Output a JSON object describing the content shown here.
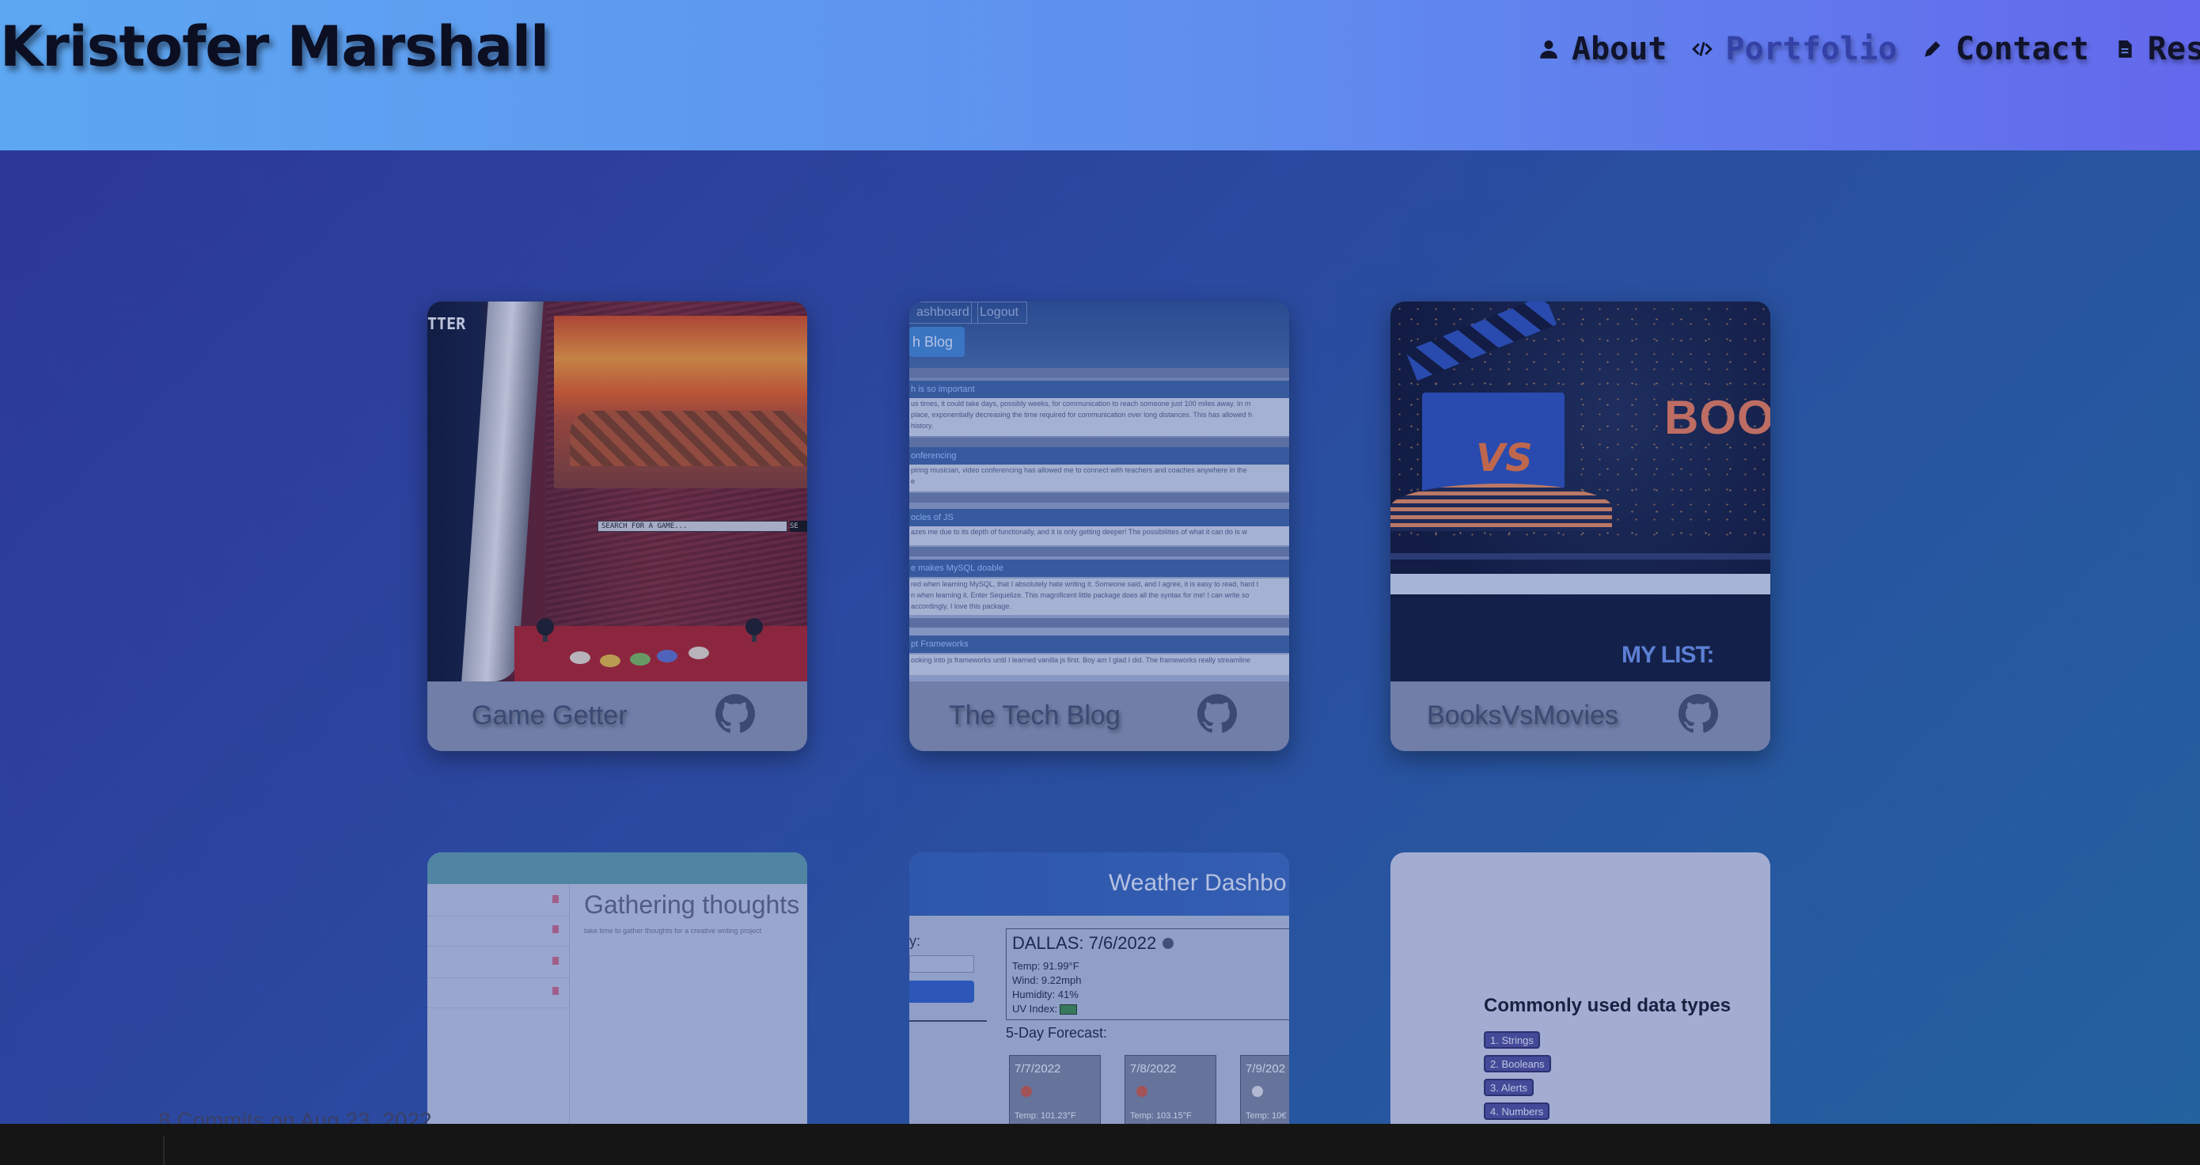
{
  "header": {
    "site_title": "Kristofer Marshall",
    "nav": [
      {
        "label": "About",
        "icon": "user-icon"
      },
      {
        "label": "Portfolio",
        "icon": "code-icon",
        "active": true
      },
      {
        "label": "Contact",
        "icon": "pen-icon"
      },
      {
        "label": "Resume",
        "icon": "document-icon"
      }
    ]
  },
  "projects": [
    {
      "title": "Game Getter",
      "screenshot": {
        "banner": "TTER",
        "search_placeholder": "SEARCH FOR A GAME...",
        "search_button": "SE"
      }
    },
    {
      "title": "The Tech Blog",
      "screenshot": {
        "nav": [
          "ashboard",
          "Logout"
        ],
        "home": "h Blog",
        "posts": [
          {
            "title": "h is so important",
            "body": [
              "us times, it could take days, possibly weeks, for communication to reach someone just 100 miles away. In m",
              "place, exponentially decreasing the time required for communication over long distances. This has allowed h",
              "history."
            ]
          },
          {
            "title": "onferencing",
            "body": [
              "piring musician, video conferencing has allowed me to connect with teachers and coaches anywhere in the",
              "e"
            ]
          },
          {
            "title": "ocles of JS",
            "body": [
              "azes me due to its depth of functionally, and it is only getting deeper! The possibilities of what it can do is w"
            ]
          },
          {
            "title": "e makes MySQL doable",
            "body": [
              "red when learning MySQL, that I absolutely hate writing it. Someone said, and I agree, it is easy to read, hard t",
              "n when learning it. Enter Sequelize. This magnificent little package does all the syntax for me! I can write so",
              "accordingly. I love this package."
            ]
          },
          {
            "title": "pt Frameworks",
            "body": [
              "ooking into js frameworks until I learned vanilla js first. Boy am I glad I did. The frameworks really streamline"
            ]
          }
        ]
      }
    },
    {
      "title": "BooksVsMovies",
      "screenshot": {
        "vs": "VS",
        "books": "BOOKS",
        "my_list": "MY LIST:"
      }
    }
  ],
  "projects_row2": [
    {
      "screenshot": {
        "title": "Gathering thoughts",
        "subtitle": "take time to gather thoughts for a creative writing project"
      }
    },
    {
      "screenshot": {
        "title": "Weather Dashbo",
        "search_label": "y:",
        "city": "DALLAS: 7/6/2022",
        "temp": "Temp: 91.99°F",
        "wind": "Wind: 9.22mph",
        "humidity": "Humidity: 41%",
        "uv": "UV Index:",
        "forecast_label": "5-Day Forecast:",
        "forecast": [
          {
            "date": "7/7/2022",
            "temp": "Temp: 101.23°F"
          },
          {
            "date": "7/8/2022",
            "temp": "Temp: 103.15°F"
          },
          {
            "date": "7/9/202",
            "temp": "Temp: 10€"
          }
        ]
      }
    },
    {
      "screenshot": {
        "question": "Commonly used data types",
        "options": [
          "1. Strings",
          "2. Booleans",
          "3. Alerts",
          "4. Numbers"
        ]
      }
    }
  ],
  "background_strip": {
    "text": "8    Commits on Aug 23, 2022"
  },
  "colors": {
    "header_start": "#5da7f2",
    "header_end": "#6368ec",
    "page_bg": "#2b4aa0",
    "active_nav": "#3442a8"
  }
}
